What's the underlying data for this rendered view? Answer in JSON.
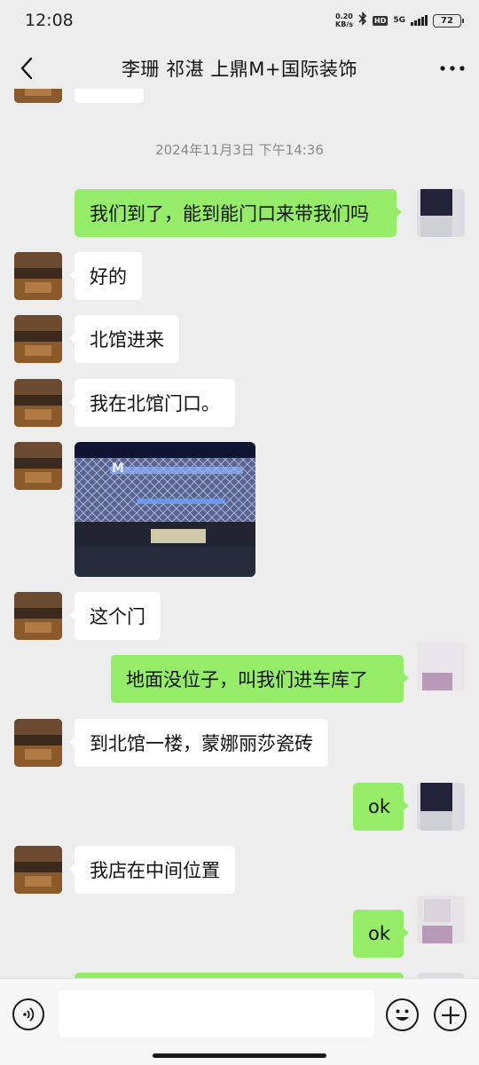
{
  "status_bar": {
    "time": "12:08",
    "net_speed_value": "0.20",
    "net_speed_unit": "KB/s",
    "hd": "HD",
    "network": "5G",
    "battery": "72"
  },
  "header": {
    "title": "李珊 祁湛 上鼎M+国际装饰",
    "back_icon": "chevron-left-icon",
    "more_icon": "more-dots-icon",
    "more_label": "···"
  },
  "chat": {
    "timestamp": "2024年11月3日 下午14:36",
    "messages": [
      {
        "side": "right",
        "type": "text",
        "text": "我们到了，能到能门口来带我们吗"
      },
      {
        "side": "left",
        "type": "text",
        "text": "好的"
      },
      {
        "side": "left",
        "type": "text",
        "text": "北馆进来"
      },
      {
        "side": "left",
        "type": "text",
        "text": "我在北馆门口。"
      },
      {
        "side": "left",
        "type": "image",
        "sign_text": "M"
      },
      {
        "side": "left",
        "type": "text",
        "text": "这个门"
      },
      {
        "side": "right",
        "type": "text",
        "text": "地面没位子，叫我们进车库了"
      },
      {
        "side": "left",
        "type": "text",
        "text": "到北馆一楼，蒙娜丽莎瓷砖"
      },
      {
        "side": "right",
        "type": "text",
        "text": "ok"
      },
      {
        "side": "left",
        "type": "text",
        "text": "我店在中间位置"
      },
      {
        "side": "right",
        "type": "text",
        "text": "ok"
      }
    ]
  },
  "input_bar": {
    "voice_icon": "voice-icon",
    "emoji_icon": "emoji-icon",
    "plus_icon": "plus-icon",
    "placeholder": ""
  },
  "colors": {
    "background": "#ededed",
    "sent_bubble": "#95ec69",
    "received_bubble": "#ffffff",
    "timestamp_text": "#8a8a8a"
  }
}
